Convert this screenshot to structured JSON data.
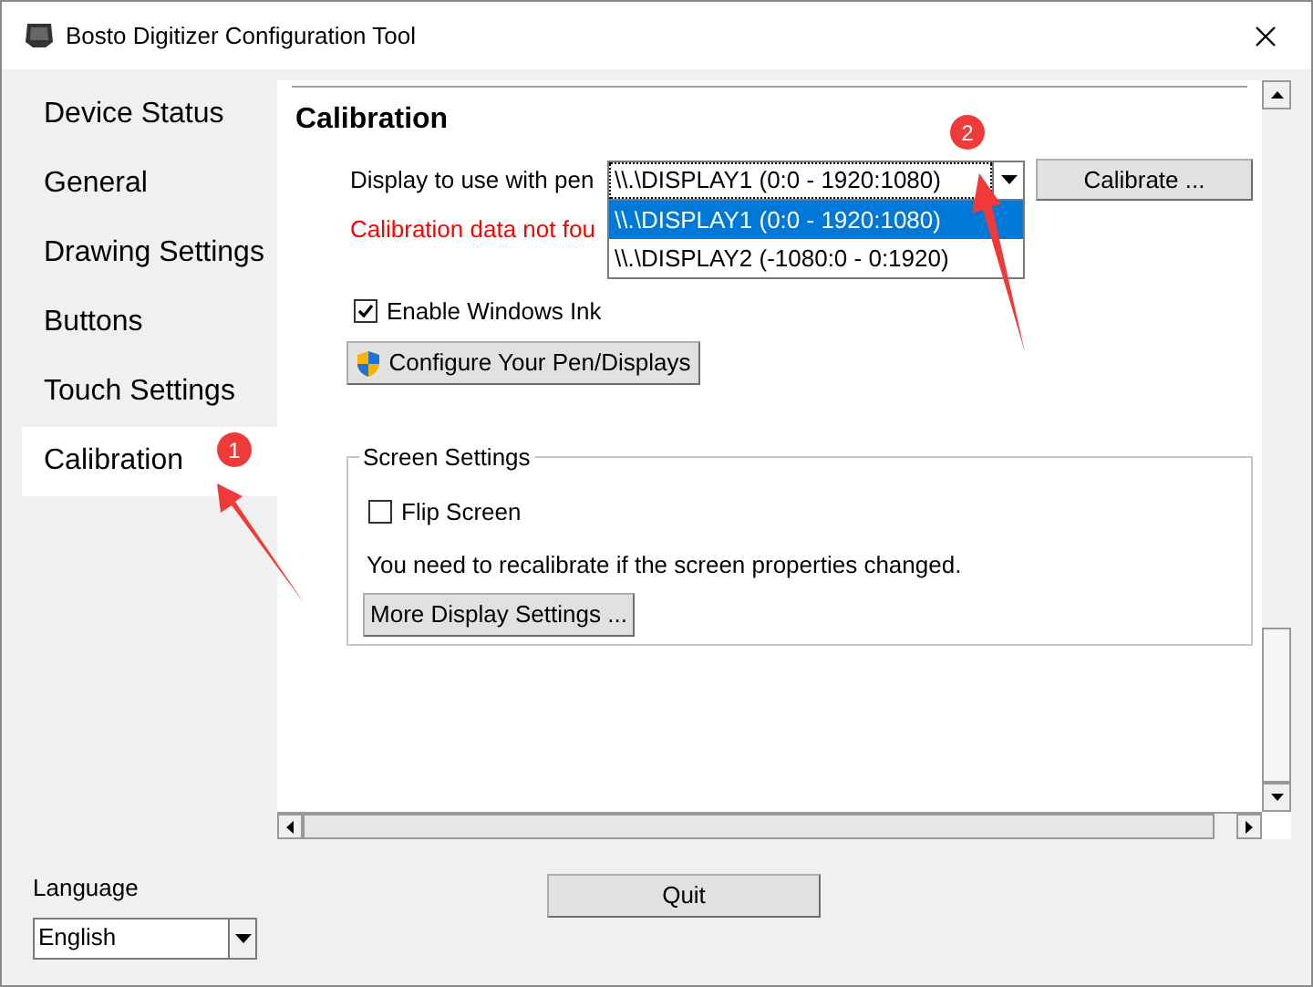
{
  "window": {
    "title": "Bosto Digitizer Configuration Tool"
  },
  "sidebar": {
    "items": [
      {
        "label": "Device Status",
        "selected": false
      },
      {
        "label": "General",
        "selected": false
      },
      {
        "label": "Drawing Settings",
        "selected": false
      },
      {
        "label": "Buttons",
        "selected": false
      },
      {
        "label": "Touch Settings",
        "selected": false
      },
      {
        "label": "Calibration",
        "selected": true
      }
    ]
  },
  "section": {
    "title": "Calibration"
  },
  "display": {
    "label": "Display to use with pen",
    "value": "\\\\.\\DISPLAY1 (0:0 - 1920:1080)",
    "expanded": true,
    "options": [
      {
        "label": "\\\\.\\DISPLAY1 (0:0 - 1920:1080)",
        "selected": true
      },
      {
        "label": "\\\\.\\DISPLAY2 (-1080:0 - 0:1920)",
        "selected": false
      }
    ]
  },
  "calibrate_button": "Calibrate ...",
  "error": "Calibration data not fou",
  "windows_ink": {
    "label": "Enable Windows Ink",
    "checked": true
  },
  "configure_button": "Configure Your Pen/Displays",
  "screen_settings": {
    "title": "Screen Settings",
    "flip": {
      "label": "Flip Screen",
      "checked": false
    },
    "note": "You need to recalibrate if the screen properties changed.",
    "button": "More Display Settings ..."
  },
  "language": {
    "label": "Language",
    "value": "English"
  },
  "quit_button": "Quit",
  "annotations": [
    {
      "label": "1"
    },
    {
      "label": "2"
    }
  ]
}
